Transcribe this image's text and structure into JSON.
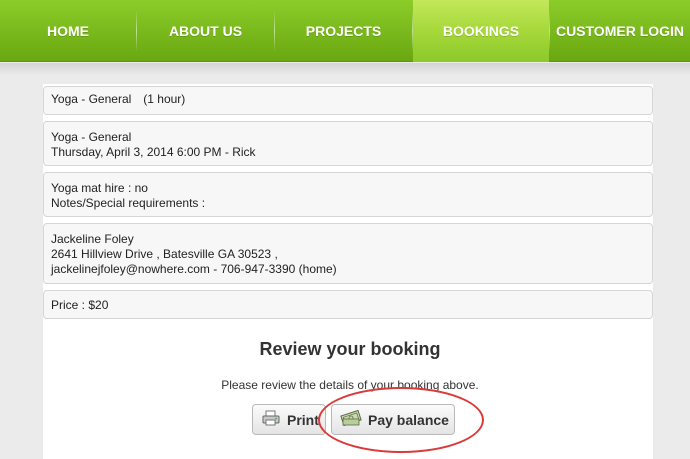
{
  "nav": {
    "items": [
      {
        "label": "HOME"
      },
      {
        "label": "ABOUT US"
      },
      {
        "label": "PROJECTS"
      },
      {
        "label": "BOOKINGS",
        "active": true
      },
      {
        "label": "CUSTOMER LOGIN"
      }
    ]
  },
  "booking": {
    "service": "Yoga - General",
    "duration": "(1 hour)",
    "service_repeat": "Yoga - General",
    "datetime": "Thursday, April 3, 2014 6:00 PM - Rick",
    "mat_hire": "Yoga mat hire : no",
    "notes": "Notes/Special requirements :",
    "customer_name": "Jackeline Foley",
    "customer_address": "2641 Hillview Drive , Batesville GA 30523 ,",
    "customer_contact": "jackelinejfoley@nowhere.com - 706-947-3390 (home)",
    "price": "Price : $20"
  },
  "review": {
    "title": "Review your booking",
    "instructions": "Please review the details of your booking above."
  },
  "buttons": {
    "print_label": "Print",
    "pay_label": "Pay balance"
  },
  "icons": {
    "print": "printer-icon",
    "pay": "money-icon"
  },
  "colors": {
    "nav_green": "#79b81b",
    "nav_active": "#a6d83a",
    "highlight": "#d93a3a"
  }
}
